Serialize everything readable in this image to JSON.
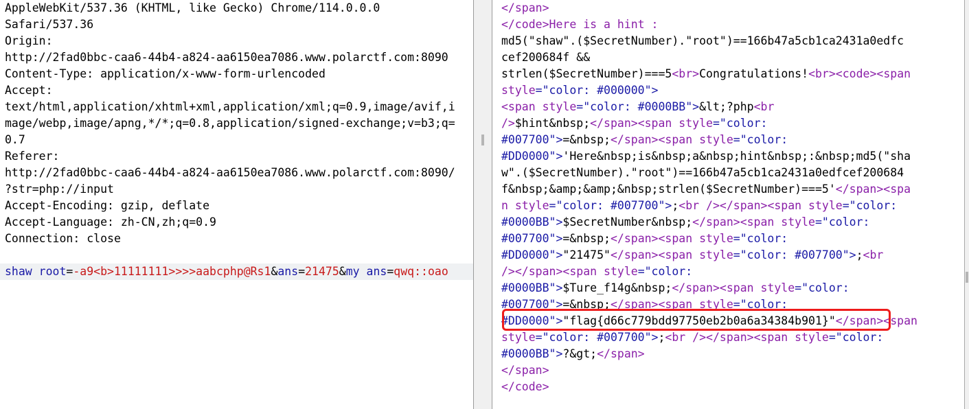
{
  "request": {
    "header_lines": [
      "AppleWebKit/537.36 (KHTML, like Gecko) Chrome/114.0.0.0",
      "Safari/537.36",
      "Origin:",
      "http://2fad0bbc-caa6-44b4-a824-aa6150ea7086.www.polarctf.com:8090",
      "Content-Type: application/x-www-form-urlencoded",
      "Accept:",
      "text/html,application/xhtml+xml,application/xml;q=0.9,image/avif,i",
      "mage/webp,image/apng,*/*;q=0.8,application/signed-exchange;v=b3;q=",
      "0.7",
      "Referer:",
      "http://2fad0bbc-caa6-44b4-a824-aa6150ea7086.www.polarctf.com:8090/",
      "?str=php://input",
      "Accept-Encoding: gzip, deflate",
      "Accept-Language: zh-CN,zh;q=0.9",
      "Connection: close",
      ""
    ],
    "params": {
      "key1": "shaw root",
      "eq1": "=",
      "val1": "-a9<b>11111111>>>>aabcphp@Rs1",
      "amp1": "&",
      "key2": "ans",
      "eq2": "=",
      "val2": "21475",
      "amp2": "&",
      "key3": "my ans",
      "eq3": "=",
      "val3": "qwq::oao"
    }
  },
  "response": {
    "lines": [
      [
        "</span>"
      ],
      [
        "</code>Here is a hint :"
      ],
      [
        "md5(\"shaw\".($SecretNumber).\"root\")==166b47a5cb1ca2431a0edfc"
      ],
      [
        "cef200684f &&"
      ],
      [
        "strlen($SecretNumber)===5",
        "<br>",
        "Congratulations!",
        "<br><code><span"
      ],
      [
        "style",
        "=\"color: #000000\">"
      ],
      [
        "<span ",
        "style",
        "=\"color: #0000BB\">",
        "&lt;?php",
        "<br"
      ],
      [
        "/>",
        "$hint&nbsp;",
        "</span><span ",
        "style",
        "=\"color:"
      ],
      [
        "#007700\">",
        "=&nbsp;",
        "</span><span ",
        "style",
        "=\"color:"
      ],
      [
        "#DD0000\">",
        "'Here&nbsp;is&nbsp;a&nbsp;hint&nbsp;:&nbsp;md5(\"sha"
      ],
      [
        "w\".($SecretNumber).\"root\")==166b47a5cb1ca2431a0edfcef200684"
      ],
      [
        "f&nbsp;&amp;&amp;&nbsp;strlen($SecretNumber)===5'",
        "</span><spa"
      ],
      [
        "n ",
        "style",
        "=\"color: #007700\">",
        ";",
        "<br />",
        "</span><span ",
        "style",
        "=\"color:"
      ],
      [
        "#0000BB\">",
        "$SecretNumber&nbsp;",
        "</span><span ",
        "style",
        "=\"color:"
      ],
      [
        "#007700\">",
        "=&nbsp;",
        "</span><span ",
        "style",
        "=\"color:"
      ],
      [
        "#DD0000\">",
        "\"21475\"",
        "</span><span ",
        "style",
        "=\"color: #007700\">",
        ";",
        "<br"
      ],
      [
        "/>",
        "</span><span ",
        "style",
        "=\"color:"
      ],
      [
        "#0000BB\">",
        "$Ture_f14g&nbsp;",
        "</span><span ",
        "style",
        "=\"color:"
      ],
      [
        "#007700\">",
        "=&nbsp;",
        "</span><span ",
        "style",
        "=\"color:"
      ],
      [
        "#DD0000\">",
        "\"flag{d66c779bdd97750eb2b0a6a34384b901}\"",
        "</span><span"
      ],
      [
        "style",
        "=\"color: #007700\">",
        ";",
        "<br />",
        "</span><span ",
        "style",
        "=\"color:"
      ],
      [
        "#0000BB\">",
        "?&gt;",
        "</span>"
      ],
      [
        "</span>"
      ],
      [
        "</code>"
      ]
    ]
  },
  "colors": {
    "highlight_box": "#ee1c1c",
    "param_key": "#1a1aa6",
    "param_value": "#c81919",
    "tag": "#8a1fa8",
    "attr_value": "#1a1aa6",
    "params_line_bg": "#eff1f3"
  }
}
